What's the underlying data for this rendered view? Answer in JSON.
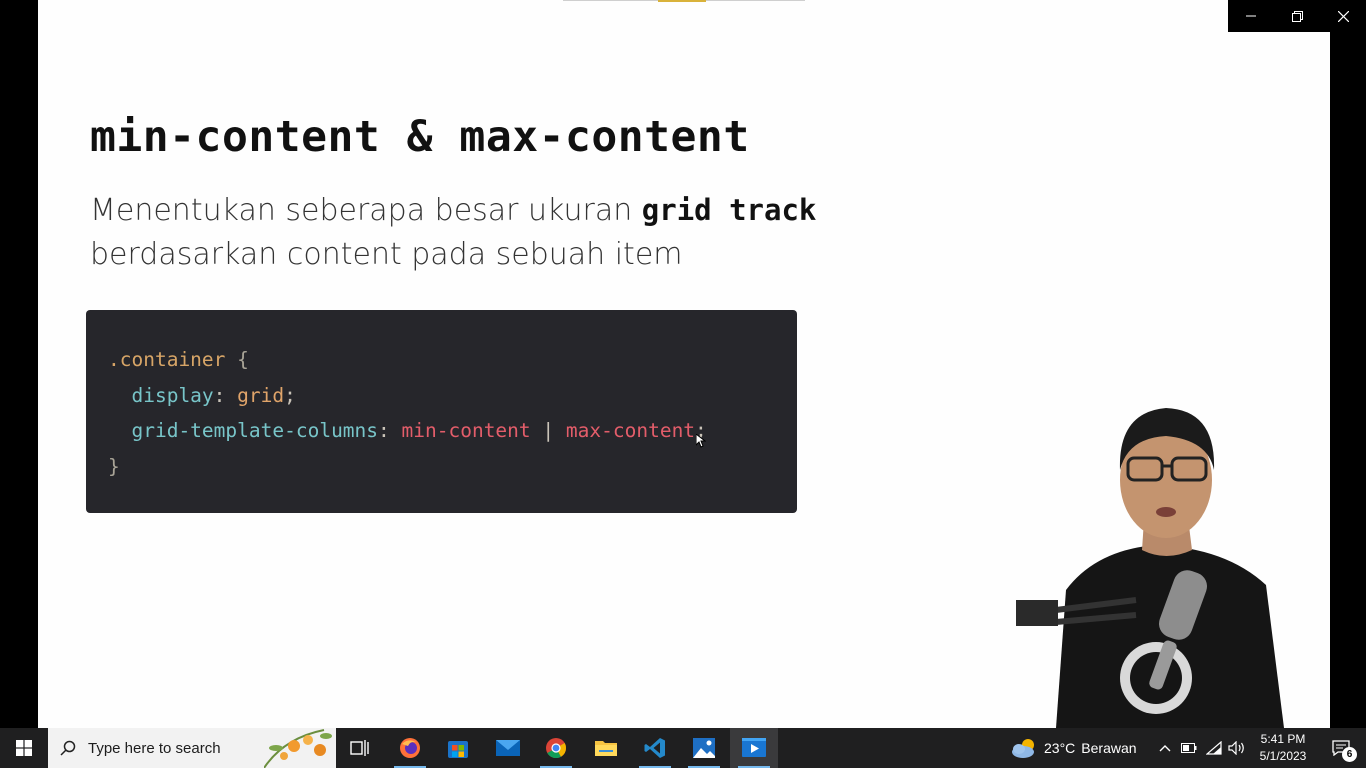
{
  "slide": {
    "title": "min-content & max-content",
    "subtitle_line1": "Menentukan seberapa besar ukuran ",
    "subtitle_keyword": "grid track",
    "subtitle_line2": "berdasarkan content pada sebuah item",
    "code": {
      "selector": ".container",
      "open_brace": "{",
      "line2_prop": "display",
      "line2_value": "grid",
      "line3_prop": "grid-template-columns",
      "line3_value1": "min-content",
      "line3_sep": "|",
      "line3_value2": "max-content",
      "close_brace": "}"
    }
  },
  "taskbar": {
    "search_placeholder": "Type here to search",
    "apps": [
      "task-view",
      "firefox",
      "microsoft-store",
      "mail",
      "chrome",
      "file-explorer",
      "vscode",
      "photos",
      "video-recorder"
    ],
    "weather_temp": "23°C",
    "weather_desc": "Berawan",
    "time": "5:41 PM",
    "date": "5/1/2023",
    "notification_count": "6"
  },
  "colors": {
    "code_bg": "#26262b",
    "code_property": "#78c5c9",
    "code_keyword": "#e35d6a",
    "code_value": "#e0a46a",
    "taskbar_bg": "#1f1f20"
  }
}
